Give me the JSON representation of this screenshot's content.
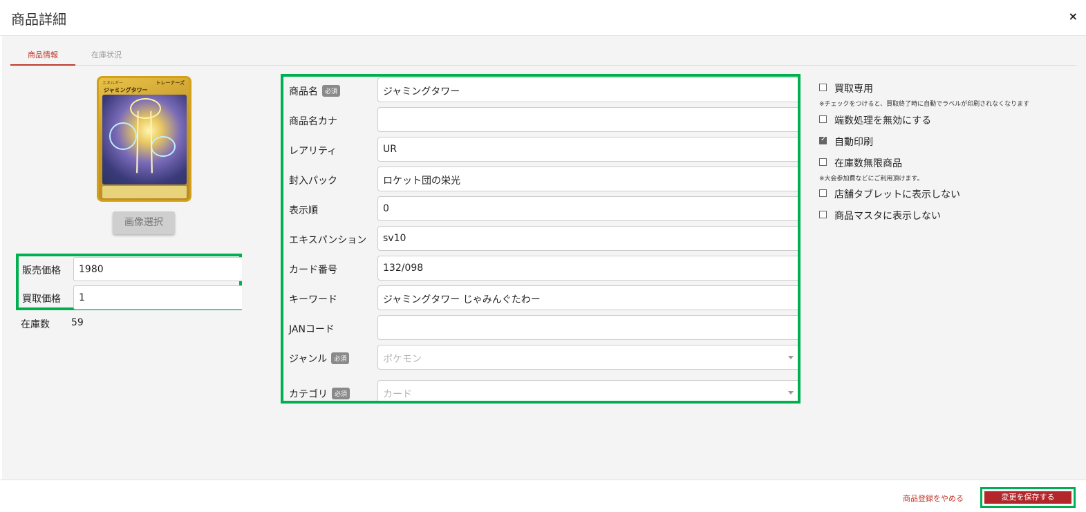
{
  "header": {
    "title": "商品詳細",
    "close_label": "×"
  },
  "tabs": [
    {
      "label": "商品情報",
      "active": true
    },
    {
      "label": "在庫状況",
      "active": false
    }
  ],
  "card": {
    "name": "ジャミングタワー",
    "subtype": "エネルギー",
    "type_label": "トレーナーズ"
  },
  "image_button_label": "画像選択",
  "prices": {
    "sell_label": "販売価格",
    "sell_value": "1980",
    "buy_label": "買取価格",
    "buy_value": "1"
  },
  "stock": {
    "label": "在庫数",
    "value": "59"
  },
  "required_badge": "必須",
  "form": {
    "name_label": "商品名",
    "name_value": "ジャミングタワー",
    "kana_label": "商品名カナ",
    "kana_value": "",
    "rarity_label": "レアリティ",
    "rarity_value": "UR",
    "pack_label": "封入パック",
    "pack_value": "ロケット団の栄光",
    "order_label": "表示順",
    "order_value": "0",
    "expansion_label": "エキスパンション",
    "expansion_value": "sv10",
    "card_no_label": "カード番号",
    "card_no_value": "132/098",
    "keyword_label": "キーワード",
    "keyword_value": "ジャミングタワー じゃみんぐたわー",
    "jan_label": "JANコード",
    "jan_value": "",
    "genre_label": "ジャンル",
    "genre_placeholder": "ポケモン",
    "category_label": "カテゴリ",
    "category_placeholder": "カード"
  },
  "checks": {
    "buy_only": {
      "label": "買取専用",
      "checked": false
    },
    "buy_only_note": "※チェックをつけると、買取終了時に自動でラベルが印刷されなくなります",
    "rounding": {
      "label": "端数処理を無効にする",
      "checked": false
    },
    "auto_print": {
      "label": "自動印刷",
      "checked": true
    },
    "unlimited": {
      "label": "在庫数無限商品",
      "checked": false
    },
    "unlimited_note": "※大会参加費などにご利用頂けます。",
    "hide_tablet": {
      "label": "店舗タブレットに表示しない",
      "checked": false
    },
    "hide_master": {
      "label": "商品マスタに表示しない",
      "checked": false
    }
  },
  "footer": {
    "cancel_label": "商品登録をやめる",
    "save_label": "変更を保存する"
  },
  "colors": {
    "accent": "#c0392b",
    "save_button": "#b3262a",
    "highlight": "#00b050"
  }
}
